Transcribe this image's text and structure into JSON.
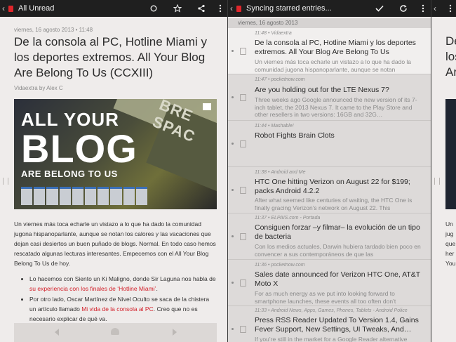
{
  "left_pane": {
    "toolbar": {
      "title": "All Unread",
      "icons": [
        "back-chevron-icon",
        "app-logo-icon",
        "circle-icon",
        "star-icon",
        "share-icon",
        "overflow-menu-icon"
      ]
    },
    "article": {
      "date": "viernes, 16 agosto 2013 • 11:48",
      "title": "De la consola al PC, Hotline Miami y los deportes extremos. All Your Blog Are Belong To Us (CCXIII)",
      "byline": "Vidaextra by Alex C",
      "hero_text": {
        "line1": "ALL YOUR",
        "line2": "BLOG",
        "line3": "ARE BELONG TO US",
        "corner": "BRE SPAC"
      },
      "paragraph": "Un viernes más toca echarle un vistazo a lo que ha dado la comunidad jugona hispanoparlante, aunque se notan los calores y las vacaciones que dejan casi desiertos un buen puñado de blogs. Normal. En todo caso hemos rescatado algunas lecturas interesantes. Empecemos con el All Your Blog Belong To Us de hoy.",
      "bullets": [
        {
          "before": "Lo hacemos con Siento un Ki Maligno, donde Sir Laguna nos habla de ",
          "link": "su experiencia con los finales de ‘Hotline Miami’",
          "after": "."
        },
        {
          "before": "Por otro lado, Oscar Martínez de Nivel Oculto se saca de la chistera un artículo llamado ",
          "link": "Mi vida de la consola al PC",
          "after": ". Creo que no es necesario explicar de qué va."
        }
      ]
    }
  },
  "middle_pane": {
    "toolbar": {
      "title": "Syncing starred entries...",
      "icons": [
        "back-chevron-icon",
        "app-logo-icon",
        "checkmark-icon",
        "refresh-icon",
        "overflow-menu-icon"
      ]
    },
    "date_header": "viernes, 16 agosto 2013",
    "entries": [
      {
        "meta": "11:48 • Vidaextra",
        "title": "De la consola al PC, Hotline Miami y los deportes extremos. All Your Blog Are Belong To Us",
        "snippet": "Un viernes más toca echarle un vistazo a lo que ha dado la comunidad jugona hispanoparlante, aunque se notan",
        "state": "unread"
      },
      {
        "meta": "11:47 • pocketnow.com",
        "title": "Are you holding out for the LTE Nexus 7?",
        "snippet": "Three weeks ago Google announced the new version of its 7-inch tablet, the 2013 Nexus 7. It came to the Play Store and other resellers in two versions: 16GB and 32G…",
        "state": "read"
      },
      {
        "meta": "11:44 • Mashable!",
        "title": "Robot Fights Brain Clots",
        "snippet": "",
        "state": "read"
      },
      {
        "meta": "11:38 • Android and Me",
        "title": "HTC One hitting Verizon on August 22 for $199; packs Android 4.2.2",
        "snippet": "After what seemed like centuries of waiting, the HTC One is finally gracing Verizon’s network on August 22. This",
        "state": "read"
      },
      {
        "meta": "11:37 • ELPAIS.com - Portada",
        "title": "Consiguen forzar –y filmar– la evolución de un tipo de bacteria",
        "snippet": "Con los medios actuales, Darwin hubiera tardado bien poco en convencer a sus contemporáneos de que las",
        "state": "read"
      },
      {
        "meta": "11:36 • pocketnow.com",
        "title": "Sales date announced for Verizon HTC One, AT&T Moto X",
        "snippet": "For as much energy as we put into looking forward to smartphone launches, these events all too often don’t",
        "state": "read"
      },
      {
        "meta": "11:33 • Android News, Apps, Games, Phones, Tablets - Android Police",
        "title": "Press RSS Reader Updated To Version 1.4, Gains Fever Support, New Settings, UI Tweaks, And…",
        "snippet": "If you’re still in the market for a Google Reader alternative",
        "state": "read"
      }
    ]
  },
  "right_pane": {
    "toolbar": {
      "icons": [
        "back-chevron-icon",
        "overflow-menu-icon"
      ]
    },
    "title_fragment": "De l\nlos\nAre",
    "body_fragment": "Un\njug\nque\nher\nYou"
  },
  "colors": {
    "toolbar_bg": "#1f1f1f",
    "accent_red": "#e0262b",
    "link_red": "#d3202a",
    "article_bg": "#efeceb",
    "read_row_bg": "#dddad9",
    "unread_row_bg": "#f1efee"
  }
}
